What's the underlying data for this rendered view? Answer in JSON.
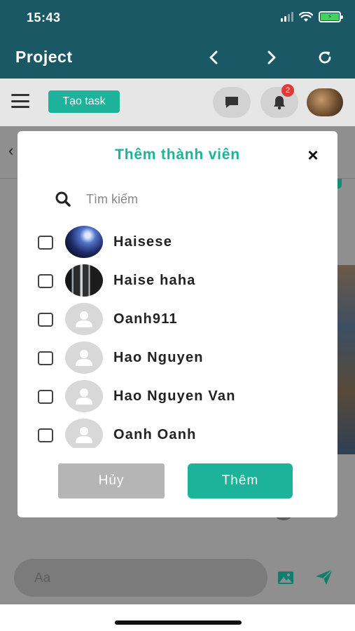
{
  "status_bar": {
    "time": "15:43"
  },
  "header": {
    "title": "Project",
    "prev_icon": "chevron-left-icon",
    "next_icon": "chevron-right-icon",
    "refresh_icon": "refresh-icon"
  },
  "toolbar": {
    "create_task_label": "Tạo task",
    "notification_count": "2"
  },
  "chat_input": {
    "placeholder": "Aa"
  },
  "modal": {
    "title": "Thêm thành viên",
    "close_label": "×",
    "search_placeholder": "Tìm kiếm",
    "members": [
      {
        "name": "Haisese",
        "avatar": "photo",
        "checked": false
      },
      {
        "name": "Haise haha",
        "avatar": "photo",
        "checked": false
      },
      {
        "name": "Oanh911",
        "avatar": "default-user-icon",
        "checked": false
      },
      {
        "name": "Hao Nguyen",
        "avatar": "default-user-icon",
        "checked": false
      },
      {
        "name": "Hao Nguyen Van",
        "avatar": "default-user-icon",
        "checked": false
      },
      {
        "name": "Oanh Oanh",
        "avatar": "default-user-icon",
        "checked": false
      }
    ],
    "cancel_label": "Hủy",
    "confirm_label": "Thêm"
  },
  "colors": {
    "header_bg": "#1a5866",
    "accent": "#1db29a",
    "badge": "#e53935",
    "cancel_bg": "#b5b5b5"
  }
}
